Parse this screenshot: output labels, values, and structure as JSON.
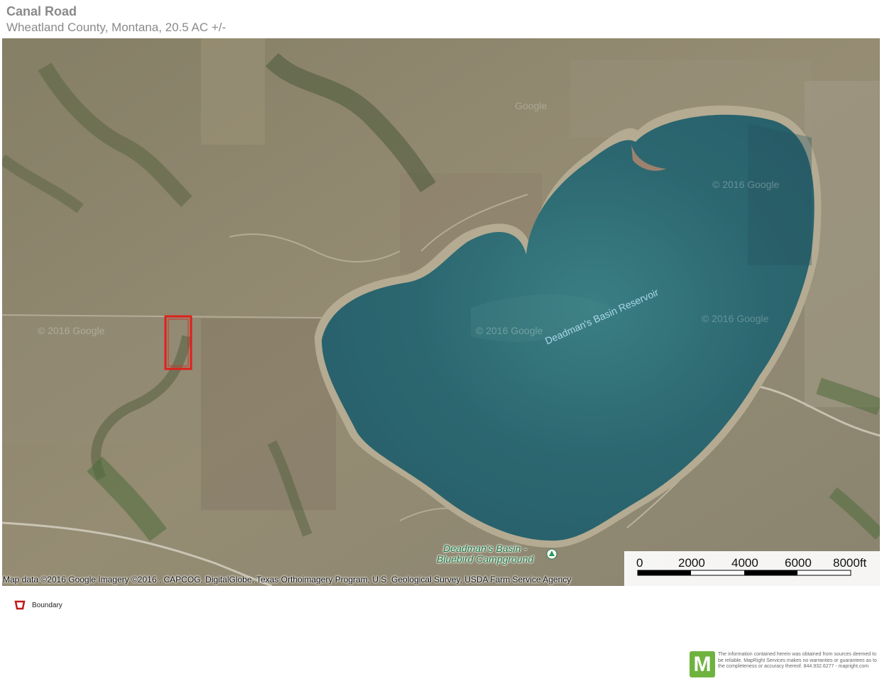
{
  "header": {
    "title": "Canal Road",
    "subtitle": "Wheatland County, Montana, 20.5  AC +/-"
  },
  "map": {
    "water_label": "Deadman's Basin Reservoir",
    "campground_label_line1": "Deadman's Basin -",
    "campground_label_line2": "Bluebird Campground",
    "watermarks": [
      "© 2016 Google",
      "© 2016 Google",
      "© 2016 Google",
      "© 2016 Google",
      "Google"
    ],
    "attribution": "Map data ©2016 Google  Imagery ©2016 , CAPCOG, DigitalGlobe, Texas Orthoimagery Program, U.S. Geological Survey, USDA Farm Service Agency",
    "scale": {
      "labels": [
        "0",
        "2000",
        "4000",
        "6000",
        "8000ft"
      ]
    },
    "colors": {
      "boundary": "#e0201c",
      "water": "#2f6f78",
      "land": "#8c8670"
    }
  },
  "legend": {
    "boundary_label": "Boundary"
  },
  "footer": {
    "logo_letter": "M",
    "disclaimer": "The information contained herein was obtained from sources deemed to be reliable. MapRight Services makes no warranties or guarantees as to the completeness or accuracy thereof. 844.932.6277 - mapright.com"
  }
}
